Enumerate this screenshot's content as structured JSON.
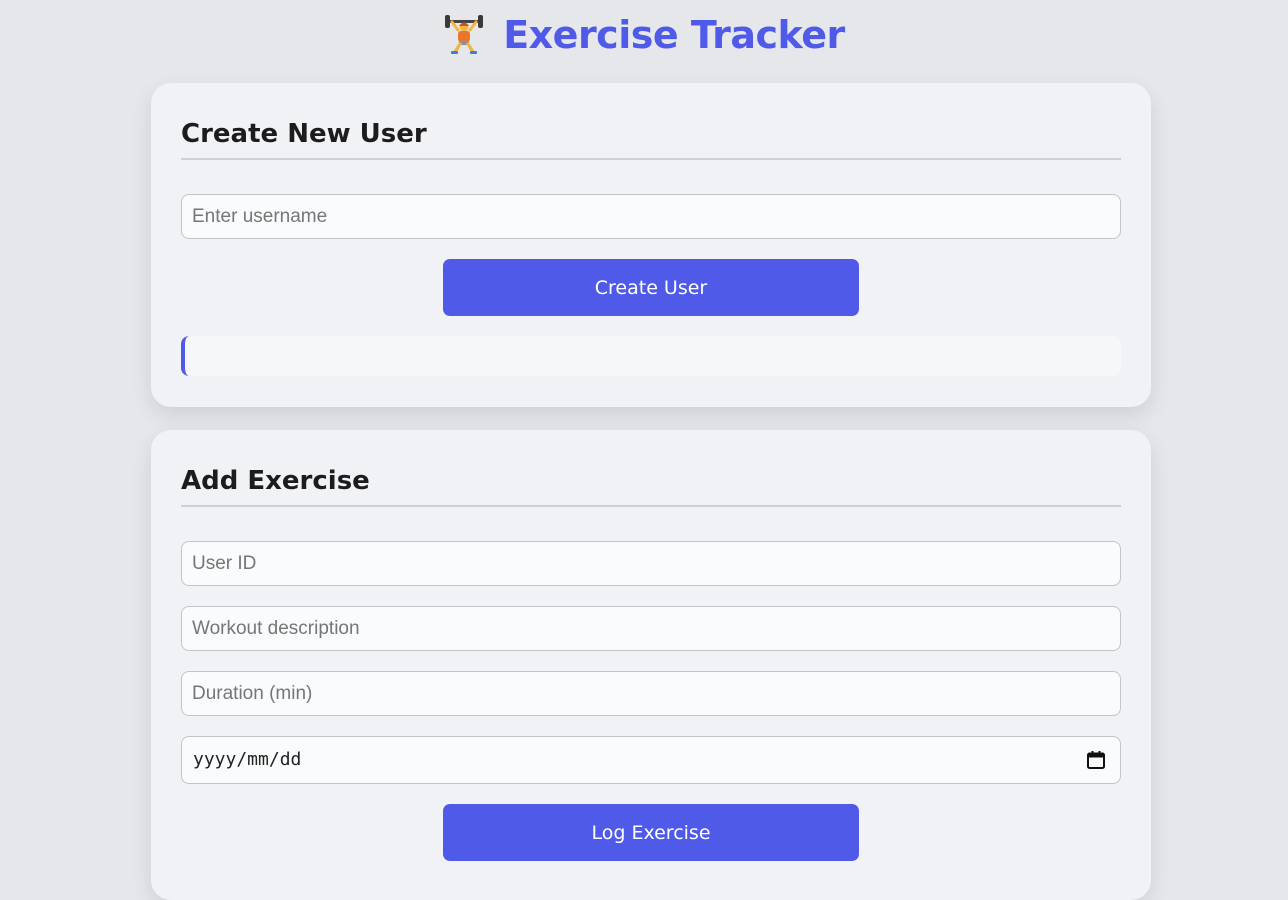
{
  "app": {
    "title": "Exercise Tracker",
    "logo_icon": "weightlifter-icon"
  },
  "create_user": {
    "heading": "Create New User",
    "username_placeholder": "Enter username",
    "button_label": "Create User",
    "result_text": ""
  },
  "add_exercise": {
    "heading": "Add Exercise",
    "user_id_placeholder": "User ID",
    "description_placeholder": "Workout description",
    "duration_placeholder": "Duration (min)",
    "date_placeholder": "yyyy/mm/dd",
    "date_icon": "calendar-icon",
    "button_label": "Log Exercise"
  },
  "colors": {
    "accent": "#4f5ae8",
    "page_background": "#e6e7eb",
    "card_background": "#f1f2f5"
  }
}
